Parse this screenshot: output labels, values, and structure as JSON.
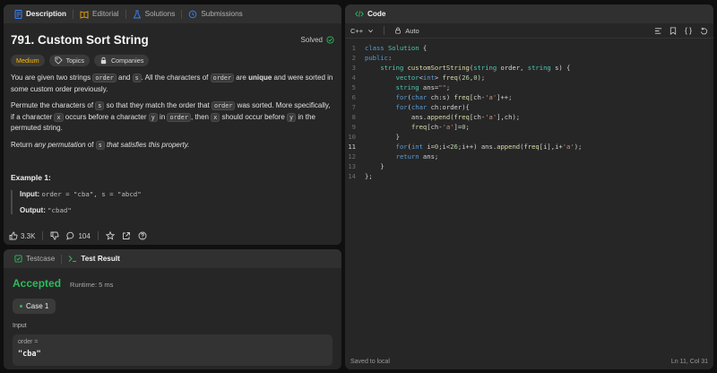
{
  "desc_tabs": [
    {
      "label": "Description",
      "icon": "document-icon"
    },
    {
      "label": "Editorial",
      "icon": "book-icon"
    },
    {
      "label": "Solutions",
      "icon": "flask-icon"
    },
    {
      "label": "Submissions",
      "icon": "history-icon"
    }
  ],
  "problem": {
    "title": "791. Custom Sort String",
    "status": "Solved",
    "difficulty": "Medium",
    "topics_label": "Topics",
    "companies_label": "Companies",
    "p1": [
      "You are given two strings ",
      "order",
      " and ",
      "s",
      ". All the characters of ",
      "order",
      " are ",
      "unique",
      " and were sorted in some custom order previously."
    ],
    "p2": [
      "Permute the characters of ",
      "s",
      " so that they match the order that ",
      "order",
      " was sorted. More specifically, if a character ",
      "x",
      " occurs before a character ",
      "y",
      " in ",
      "order",
      ", then ",
      "x",
      " should occur before ",
      "y",
      " in the permuted string."
    ],
    "p3": [
      "Return ",
      "any permutation",
      " of ",
      "s",
      " that satisfies this property."
    ],
    "example_title": "Example 1:",
    "example_input_label": "Input:",
    "example_input": "order = \"cba\", s = \"abcd\"",
    "example_output_label": "Output:",
    "example_output": "\"cbad\""
  },
  "footer": {
    "likes": "3.3K",
    "comments": "104"
  },
  "result_tabs": [
    {
      "label": "Testcase",
      "icon": "check-square-icon"
    },
    {
      "label": "Test Result",
      "icon": "terminal-icon"
    }
  ],
  "result": {
    "status": "Accepted",
    "runtime": "Runtime: 5 ms",
    "case_label": "Case 1",
    "input_label": "Input",
    "input_key": "order =",
    "input_value": "\"cba\""
  },
  "code": {
    "tab_label": "Code",
    "language": "C++",
    "mode": "Auto",
    "saved": "Saved to local",
    "cursor": "Ln 11, Col 31",
    "current_line": 11,
    "lines": [
      "class Solution {",
      "public:",
      "    string customSortString(string order, string s) {",
      "        vector<int> freq(26,0);",
      "        string ans=\"\";",
      "        for(char ch:s) freq[ch-'a']++;",
      "        for(char ch:order){",
      "            ans.append(freq[ch-'a'],ch);",
      "            freq[ch-'a']=0;",
      "        }",
      "        for(int i=0;i<26;i++) ans.append(freq[i],i+'a');",
      "        return ans;",
      "    }",
      "};"
    ]
  },
  "colors": {
    "accent_green": "#2cbb5d",
    "medium": "#ffb800",
    "keyword": "#569cd6",
    "type": "#4ec9b0",
    "string": "#ce9178",
    "number": "#b5cea8",
    "func": "#dcdcaa"
  }
}
